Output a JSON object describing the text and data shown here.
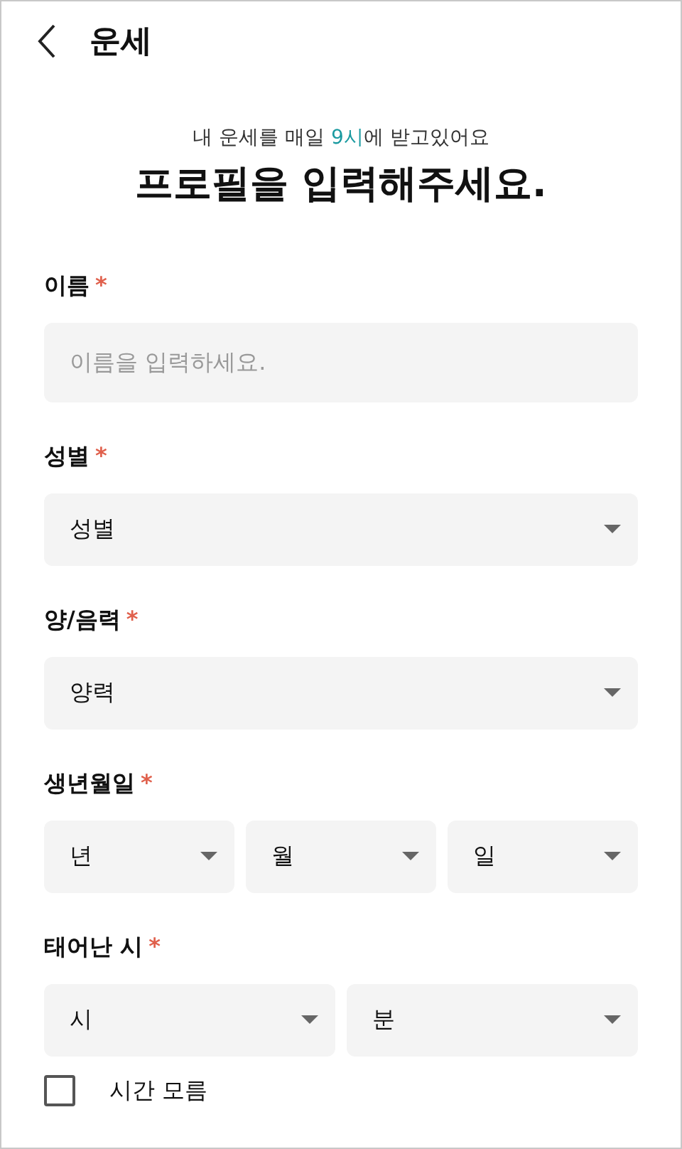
{
  "header": {
    "title": "운세"
  },
  "subtitle": {
    "before": "내 운세를 매일 ",
    "highlight": "9시",
    "after": "에 받고있어요"
  },
  "heading": "프로필을 입력해주세요.",
  "fields": [
    {
      "label": "이름",
      "required_mark": "*",
      "kind": "text",
      "placeholder": "이름을 입력하세요."
    },
    {
      "label": "성별",
      "required_mark": "*",
      "kind": "select",
      "selects": [
        "성별"
      ]
    },
    {
      "label": "양/음력",
      "required_mark": "*",
      "kind": "select",
      "selects": [
        "양력"
      ]
    },
    {
      "label": "생년월일",
      "required_mark": "*",
      "kind": "select",
      "selects": [
        "년",
        "월",
        "일"
      ]
    },
    {
      "label": "태어난 시",
      "required_mark": "*",
      "kind": "select",
      "selects": [
        "시",
        "분"
      ]
    }
  ],
  "checkbox": {
    "label": "시간 모름",
    "checked": false
  }
}
